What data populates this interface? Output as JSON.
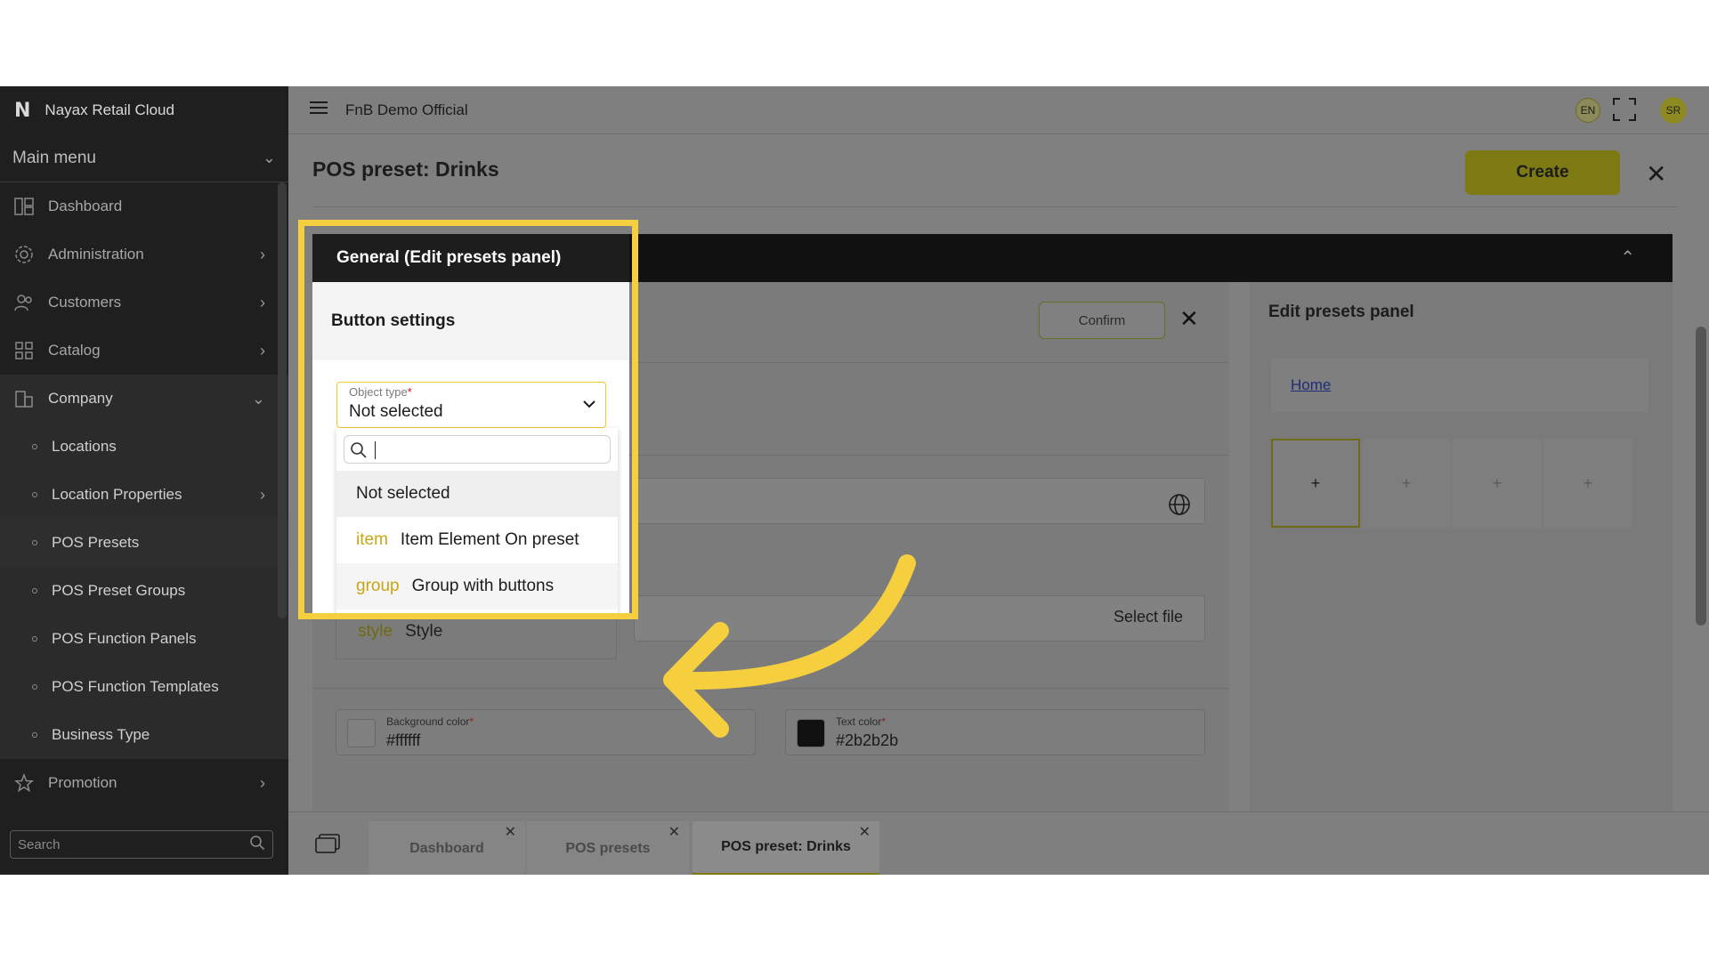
{
  "sidebar": {
    "brand": "Nayax Retail Cloud",
    "main_menu": "Main menu",
    "items": [
      {
        "label": "Dashboard"
      },
      {
        "label": "Administration"
      },
      {
        "label": "Customers"
      },
      {
        "label": "Catalog"
      },
      {
        "label": "Company"
      },
      {
        "label": "Locations"
      },
      {
        "label": "Location Properties"
      },
      {
        "label": "POS Presets"
      },
      {
        "label": "POS Preset Groups"
      },
      {
        "label": "POS Function Panels"
      },
      {
        "label": "POS Function Templates"
      },
      {
        "label": "Business Type"
      },
      {
        "label": "Promotion"
      }
    ],
    "search_placeholder": "Search"
  },
  "topbar": {
    "org_name": "FnB Demo Official",
    "lang": "EN",
    "avatar": "SR"
  },
  "page": {
    "title": "POS preset: Drinks",
    "create_label": "Create"
  },
  "editor": {
    "confirm_label": "Confirm",
    "select_file": "Select file",
    "style_option": {
      "keyword": "style",
      "label": "Style"
    },
    "background_color": {
      "label": "Background color",
      "value": "#ffffff"
    },
    "text_color": {
      "label": "Text color",
      "value": "#2b2b2b"
    }
  },
  "right_panel": {
    "title": "Edit presets panel",
    "home_link": "Home",
    "slots": [
      "+",
      "+",
      "+",
      "+"
    ]
  },
  "popup": {
    "header": "General (Edit presets panel)",
    "section": "Button settings",
    "object_type_label": "Object type",
    "object_type_value": "Not selected",
    "options": [
      {
        "keyword": "",
        "label": "Not selected"
      },
      {
        "keyword": "item",
        "label": "Item Element On preset"
      },
      {
        "keyword": "group",
        "label": "Group with buttons"
      }
    ]
  },
  "tabs": [
    {
      "label": "Dashboard"
    },
    {
      "label": "POS presets"
    },
    {
      "label": "POS preset: Drinks"
    }
  ],
  "colors": {
    "accent": "#f6cf3f",
    "sidebar_bg": "#1f1f1f"
  }
}
